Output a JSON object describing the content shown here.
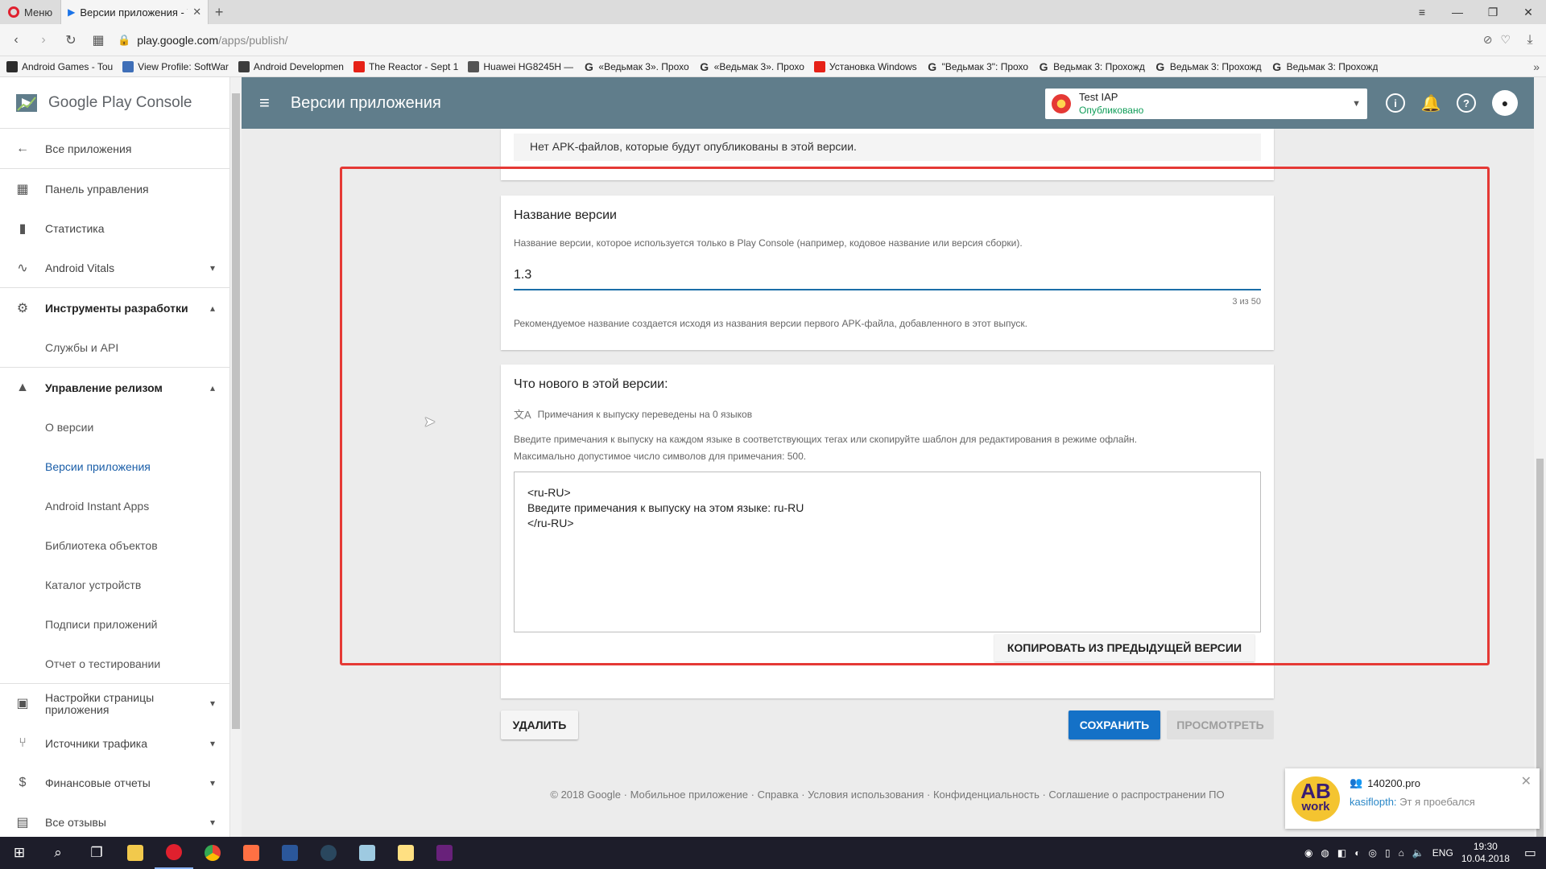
{
  "browser": {
    "menu_label": "Меню",
    "tab_title": "Версии приложения - Te",
    "url_host": "play.google.com",
    "url_path": "/apps/publish/",
    "bookmarks": [
      {
        "label": "Android Games - Tou",
        "icon": "android-games-icon"
      },
      {
        "label": "View Profile: SoftWar",
        "icon": "vk-icon"
      },
      {
        "label": "Android Developmen",
        "icon": "android-dev-icon"
      },
      {
        "label": "The Reactor - Sept 1",
        "icon": "youtube-icon"
      },
      {
        "label": "Huawei HG8245H —",
        "icon": "huawei-icon"
      },
      {
        "label": "«Ведьмак 3». Прохо",
        "icon": "g-icon"
      },
      {
        "label": "«Ведьмак 3». Прохо",
        "icon": "g-icon"
      },
      {
        "label": "Установка Windows",
        "icon": "youtube-icon"
      },
      {
        "label": "\"Ведьмак 3\": Прохо",
        "icon": "g-icon"
      },
      {
        "label": "Ведьмак 3: Прохожд",
        "icon": "g-icon"
      },
      {
        "label": "Ведьмак 3: Прохожд",
        "icon": "g-icon"
      },
      {
        "label": "Ведьмак 3: Прохожд",
        "icon": "g-icon"
      }
    ]
  },
  "sidebar": {
    "brand": "Google Play Console",
    "items": [
      {
        "label": "Все приложения",
        "icon": "arrow-back-icon"
      },
      {
        "label": "Панель управления",
        "icon": "dashboard-icon"
      },
      {
        "label": "Статистика",
        "icon": "bar-chart-icon"
      },
      {
        "label": "Android Vitals",
        "icon": "vitals-icon"
      },
      {
        "label": "Инструменты разработки",
        "icon": "dev-tools-icon"
      },
      {
        "label": "Службы и API"
      },
      {
        "label": "Управление релизом",
        "icon": "rocket-icon"
      },
      {
        "label": "О версии"
      },
      {
        "label": "Версии приложения"
      },
      {
        "label": "Android Instant Apps"
      },
      {
        "label": "Библиотека объектов"
      },
      {
        "label": "Каталог устройств"
      },
      {
        "label": "Подписи приложений"
      },
      {
        "label": "Отчет о тестировании"
      },
      {
        "label": "Настройки страницы приложения",
        "icon": "store-icon"
      },
      {
        "label": "Источники трафика",
        "icon": "traffic-icon"
      },
      {
        "label": "Финансовые отчеты",
        "icon": "dollar-icon"
      },
      {
        "label": "Все отзывы",
        "icon": "reviews-icon"
      }
    ]
  },
  "header": {
    "title": "Версии приложения",
    "app_name": "Test IAP",
    "app_status": "Опубликовано"
  },
  "main": {
    "no_apk": "Нет APK-файлов, которые будут опубликованы в этой версии.",
    "version_name": {
      "title": "Название версии",
      "desc": "Название версии, которое используется только в Play Console (например, кодовое название или версия сборки).",
      "value": "1.3",
      "counter": "3 из 50",
      "hint": "Рекомендуемое название создается исходя из названия версии первого APK-файла, добавленного в этот выпуск."
    },
    "whats_new": {
      "title": "Что нового в этой версии:",
      "translate_status": "Примечания к выпуску переведены на 0 языков",
      "desc_line1": "Введите примечания к выпуску на каждом языке в соответствующих тегах или скопируйте шаблон для редактирования в режиме офлайн.",
      "desc_line2": "Максимально допустимое число символов для примечания: 500.",
      "notes": "<ru-RU>\nВведите примечания к выпуску на этом языке: ru-RU\n</ru-RU>",
      "copy_button": "КОПИРОВАТЬ ИЗ ПРЕДЫДУЩЕЙ ВЕРСИИ"
    },
    "delete_button": "УДАЛИТЬ",
    "save_button": "СОХРАНИТЬ",
    "preview_button": "ПРОСМОТРЕТЬ",
    "footer": "© 2018 Google · Мобильное приложение · Справка · Условия использования · Конфиденциальность · Соглашение о распространении ПО"
  },
  "notification": {
    "logo_top": "AB",
    "logo_bottom": "work",
    "title": "140200.pro",
    "sender": "kasiflopth:",
    "message": "Эт я проебался"
  },
  "taskbar": {
    "lang": "ENG",
    "time": "19:30",
    "date": "10.04.2018"
  },
  "colors": {
    "header": "#607d8b",
    "accent": "#1471c7",
    "highlight_box": "#e53935",
    "active_nav": "#1a5ea8"
  }
}
